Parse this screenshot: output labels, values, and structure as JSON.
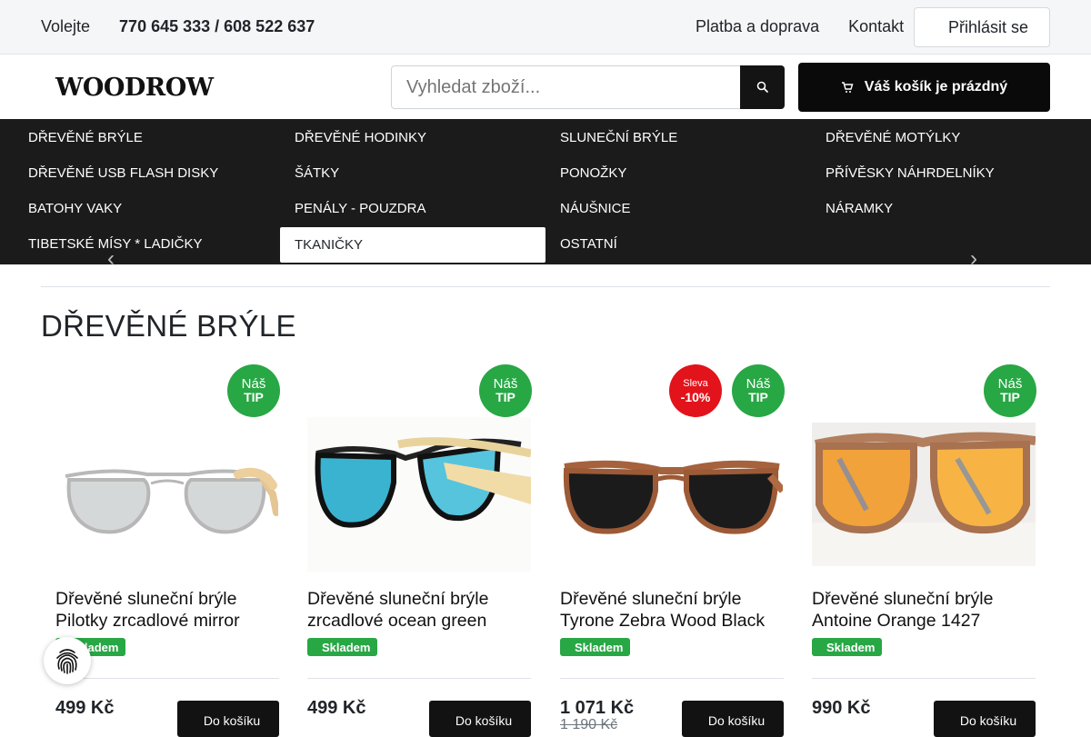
{
  "topbar": {
    "call_label": "Volejte",
    "phones": "770 645 333 / 608 522 637",
    "links": [
      "Platba a doprava",
      "Kontakt"
    ],
    "login_label": "Přihlásit se"
  },
  "header": {
    "logo": "WOODROW",
    "search_placeholder": "Vyhledat zboží...",
    "cart_label": "Váš košík je prázdný"
  },
  "categories": [
    "DŘEVĚNÉ BRÝLE",
    "DŘEVĚNÉ HODINKY",
    "SLUNEČNÍ BRÝLE",
    "DŘEVĚNÉ MOTÝLKY",
    "DŘEVĚNÉ USB FLASH DISKY",
    "ŠÁTKY",
    "PONOŽKY",
    "PŘÍVĚSKY NÁHRDELNÍKY",
    "BATOHY VAKY",
    "PENÁLY - POUZDRA",
    "NÁUŠNICE",
    "NÁRAMKY",
    "TIBETSKÉ MÍSY * LADIČKY",
    "TKANIČKY",
    "OSTATNÍ"
  ],
  "active_category": "TKANIČKY",
  "section_title": "DŘEVĚNÉ BRÝLE",
  "products": [
    {
      "name": "Dřevěné sluneční brýle Pilotky zrcadlové mirror",
      "stock": "Skladem",
      "price": "499 Kč",
      "old_price": "",
      "buy_label": "Do košíku",
      "badge_tip": [
        "Náš",
        "TIP"
      ],
      "badge_sale": null,
      "image": "aviator-silver-mirror-glasses"
    },
    {
      "name": "Dřevěné sluneční brýle zrcadlové ocean green",
      "stock": "Skladem",
      "price": "499 Kč",
      "old_price": "",
      "buy_label": "Do košíku",
      "badge_tip": [
        "Náš",
        "TIP"
      ],
      "badge_sale": null,
      "image": "wayfarer-ocean-green-glasses"
    },
    {
      "name": "Dřevěné sluneční brýle Tyrone Zebra Wood Black",
      "stock": "Skladem",
      "price": "1 071 Kč",
      "old_price": "1 190 Kč",
      "buy_label": "Do košíku",
      "badge_tip": [
        "Náš",
        "TIP"
      ],
      "badge_sale": [
        "Sleva",
        "-10%"
      ],
      "image": "wayfarer-zebra-wood-black-glasses"
    },
    {
      "name": "Dřevěné sluneční brýle Antoine Orange 1427",
      "stock": "Skladem",
      "price": "990 Kč",
      "old_price": "",
      "buy_label": "Do košíku",
      "badge_tip": [
        "Náš",
        "TIP"
      ],
      "badge_sale": null,
      "image": "wayfarer-wood-orange-mirror-glasses"
    }
  ],
  "colors": {
    "accent_green": "#28a745",
    "sale_red": "#e3131b",
    "nav_dark": "#1b1b1b"
  }
}
